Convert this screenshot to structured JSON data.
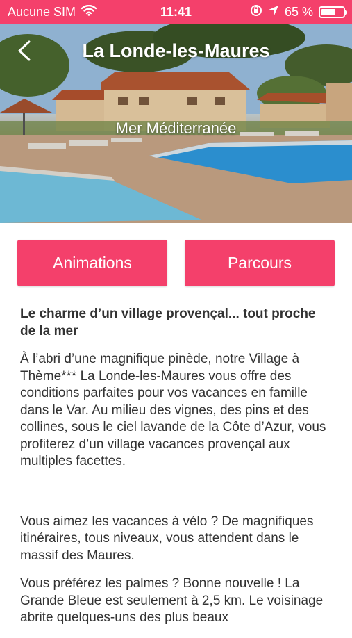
{
  "status_bar": {
    "carrier": "Aucune SIM",
    "time": "11:41",
    "battery_percent": "65 %",
    "battery_level": 0.65,
    "icons": [
      "wifi-icon",
      "orientation-lock-icon",
      "location-icon",
      "battery-icon"
    ]
  },
  "header": {
    "title": "La Londe-les-Maures",
    "subtitle": "Mer Méditerranée",
    "back_icon": "chevron-left-icon"
  },
  "buttons": {
    "animations": "Animations",
    "parcours": "Parcours"
  },
  "content": {
    "headline": "Le charme d’un village provençal... tout proche de la mer",
    "paragraphs": [
      "À l’abri d’une magnifique pinède, notre Village à Thème*** La Londe-les-Maures vous offre des conditions parfaites pour vos vacances en famille dans le Var. Au milieu des vignes, des pins et des collines, sous le ciel lavande de la Côte d’Azur, vous profiterez d’un village vacances provençal aux multiples facettes.",
      "Vous aimez les vacances à vélo ? De magnifiques itinéraires, tous niveaux, vous attendent dans le massif des Maures.",
      "Vous préférez les palmes ? Bonne nouvelle ! La Grande Bleue est seulement à 2,5 km. Le voisinage abrite quelques-uns des plus beaux"
    ]
  },
  "colors": {
    "accent": "#f4406b",
    "text": "#333333",
    "background": "#ffffff"
  }
}
